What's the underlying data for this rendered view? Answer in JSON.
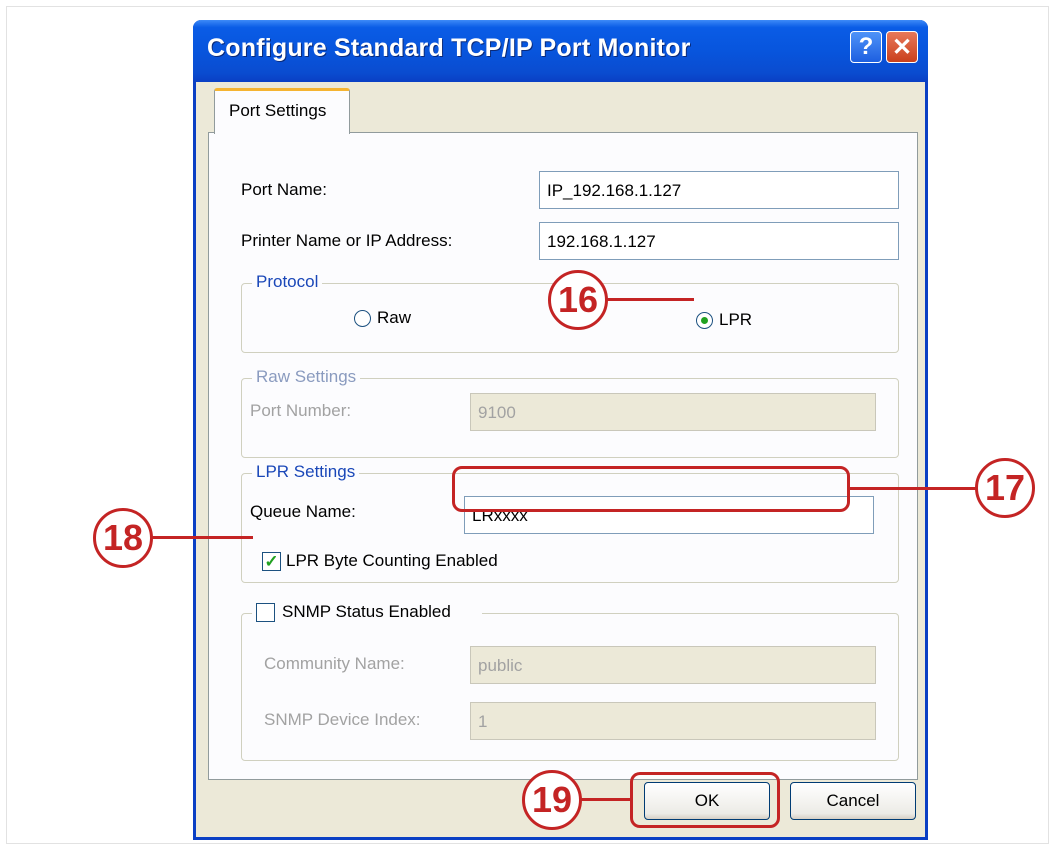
{
  "window": {
    "title": "Configure Standard TCP/IP Port Monitor"
  },
  "titlebar_buttons": {
    "help": "?",
    "close": "✕"
  },
  "tab": {
    "label": "Port Settings"
  },
  "port_name": {
    "label": "Port Name:",
    "value": "IP_192.168.1.127"
  },
  "printer_address": {
    "label": "Printer Name or IP Address:",
    "value": "192.168.1.127"
  },
  "protocol": {
    "title": "Protocol",
    "options": [
      {
        "label": "Raw",
        "selected": false
      },
      {
        "label": "LPR",
        "selected": true
      }
    ]
  },
  "raw_settings": {
    "title": "Raw Settings",
    "port_number_label": "Port Number:",
    "port_number_value": "9100"
  },
  "lpr_settings": {
    "title": "LPR Settings",
    "queue_name_label": "Queue Name:",
    "queue_name_value": "LRxxxx",
    "byte_counting_label": "LPR Byte Counting Enabled",
    "byte_counting_checked": true
  },
  "snmp": {
    "title": "SNMP Status Enabled",
    "checked": false,
    "community_label": "Community Name:",
    "community_value": "public",
    "device_index_label": "SNMP Device Index:",
    "device_index_value": "1"
  },
  "buttons": {
    "ok": "OK",
    "cancel": "Cancel"
  },
  "callouts": [
    "16",
    "17",
    "18",
    "19"
  ],
  "colors": {
    "titlebar": "#0855dd",
    "callout": "#c42424",
    "dialog_bg": "#ece9d8"
  }
}
